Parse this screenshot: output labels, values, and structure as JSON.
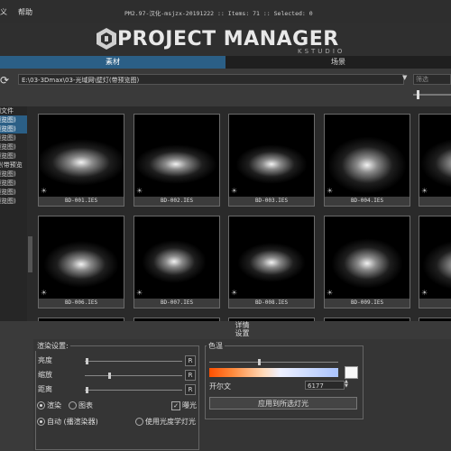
{
  "menu": {
    "items": [
      "义",
      "帮助"
    ]
  },
  "title_info": "PM2.97-汉化-msjzx-20191222  :: Items: 71  :: Selected: 0",
  "banner": {
    "logo_text": "PROJECT MANAGER",
    "logo_sub": "KSTUDIO"
  },
  "tabs": [
    {
      "label": "素材",
      "active": true
    },
    {
      "label": "场景",
      "active": false
    }
  ],
  "path": {
    "value": "E:\\03-3Dmax\\03-光域网\\壁灯(带预览图)",
    "filter_placeholder": "筛选"
  },
  "tree": {
    "items": [
      {
        "label": "网文件",
        "selected": false
      },
      {
        "label": "预览图)",
        "selected": true
      },
      {
        "label": "预览图)",
        "selected": true
      },
      {
        "label": "预览图)",
        "selected": false
      },
      {
        "label": "预览图)",
        "selected": false
      },
      {
        "label": "预览图)",
        "selected": false
      },
      {
        "label": "理(带预览",
        "selected": false
      },
      {
        "label": "预览图)",
        "selected": false
      },
      {
        "label": "预览图)",
        "selected": false
      },
      {
        "label": "预览图)",
        "selected": false
      },
      {
        "label": "预览图)",
        "selected": false
      }
    ]
  },
  "thumbnails": [
    {
      "name": "BD-001.IES"
    },
    {
      "name": "BD-002.IES"
    },
    {
      "name": "BD-003.IES"
    },
    {
      "name": "BD-004.IES"
    },
    {
      "name": ""
    },
    {
      "name": "BD-006.IES"
    },
    {
      "name": "BD-007.IES"
    },
    {
      "name": "BD-008.IES"
    },
    {
      "name": "BD-009.IES"
    },
    {
      "name": ""
    }
  ],
  "details": {
    "header": "详情",
    "subheader": "设置"
  },
  "render_settings": {
    "title": "渲染设置:",
    "sliders": [
      {
        "label": "亮度",
        "reset": "R",
        "value": 0.0
      },
      {
        "label": "缩放",
        "reset": "R",
        "value": 0.12
      },
      {
        "label": "距离",
        "reset": "R",
        "value": 0.0
      }
    ],
    "mode_render": "渲染",
    "mode_chart": "图表",
    "exposure": "曝光",
    "auto": "自动 (播渲染器)",
    "photometric": "使用光度学灯光"
  },
  "color_temp": {
    "title": "色温",
    "kelvin_label": "开尔文",
    "kelvin_value": "6177",
    "apply_button": "应用到所选灯光",
    "gradient_position": 0.38
  }
}
